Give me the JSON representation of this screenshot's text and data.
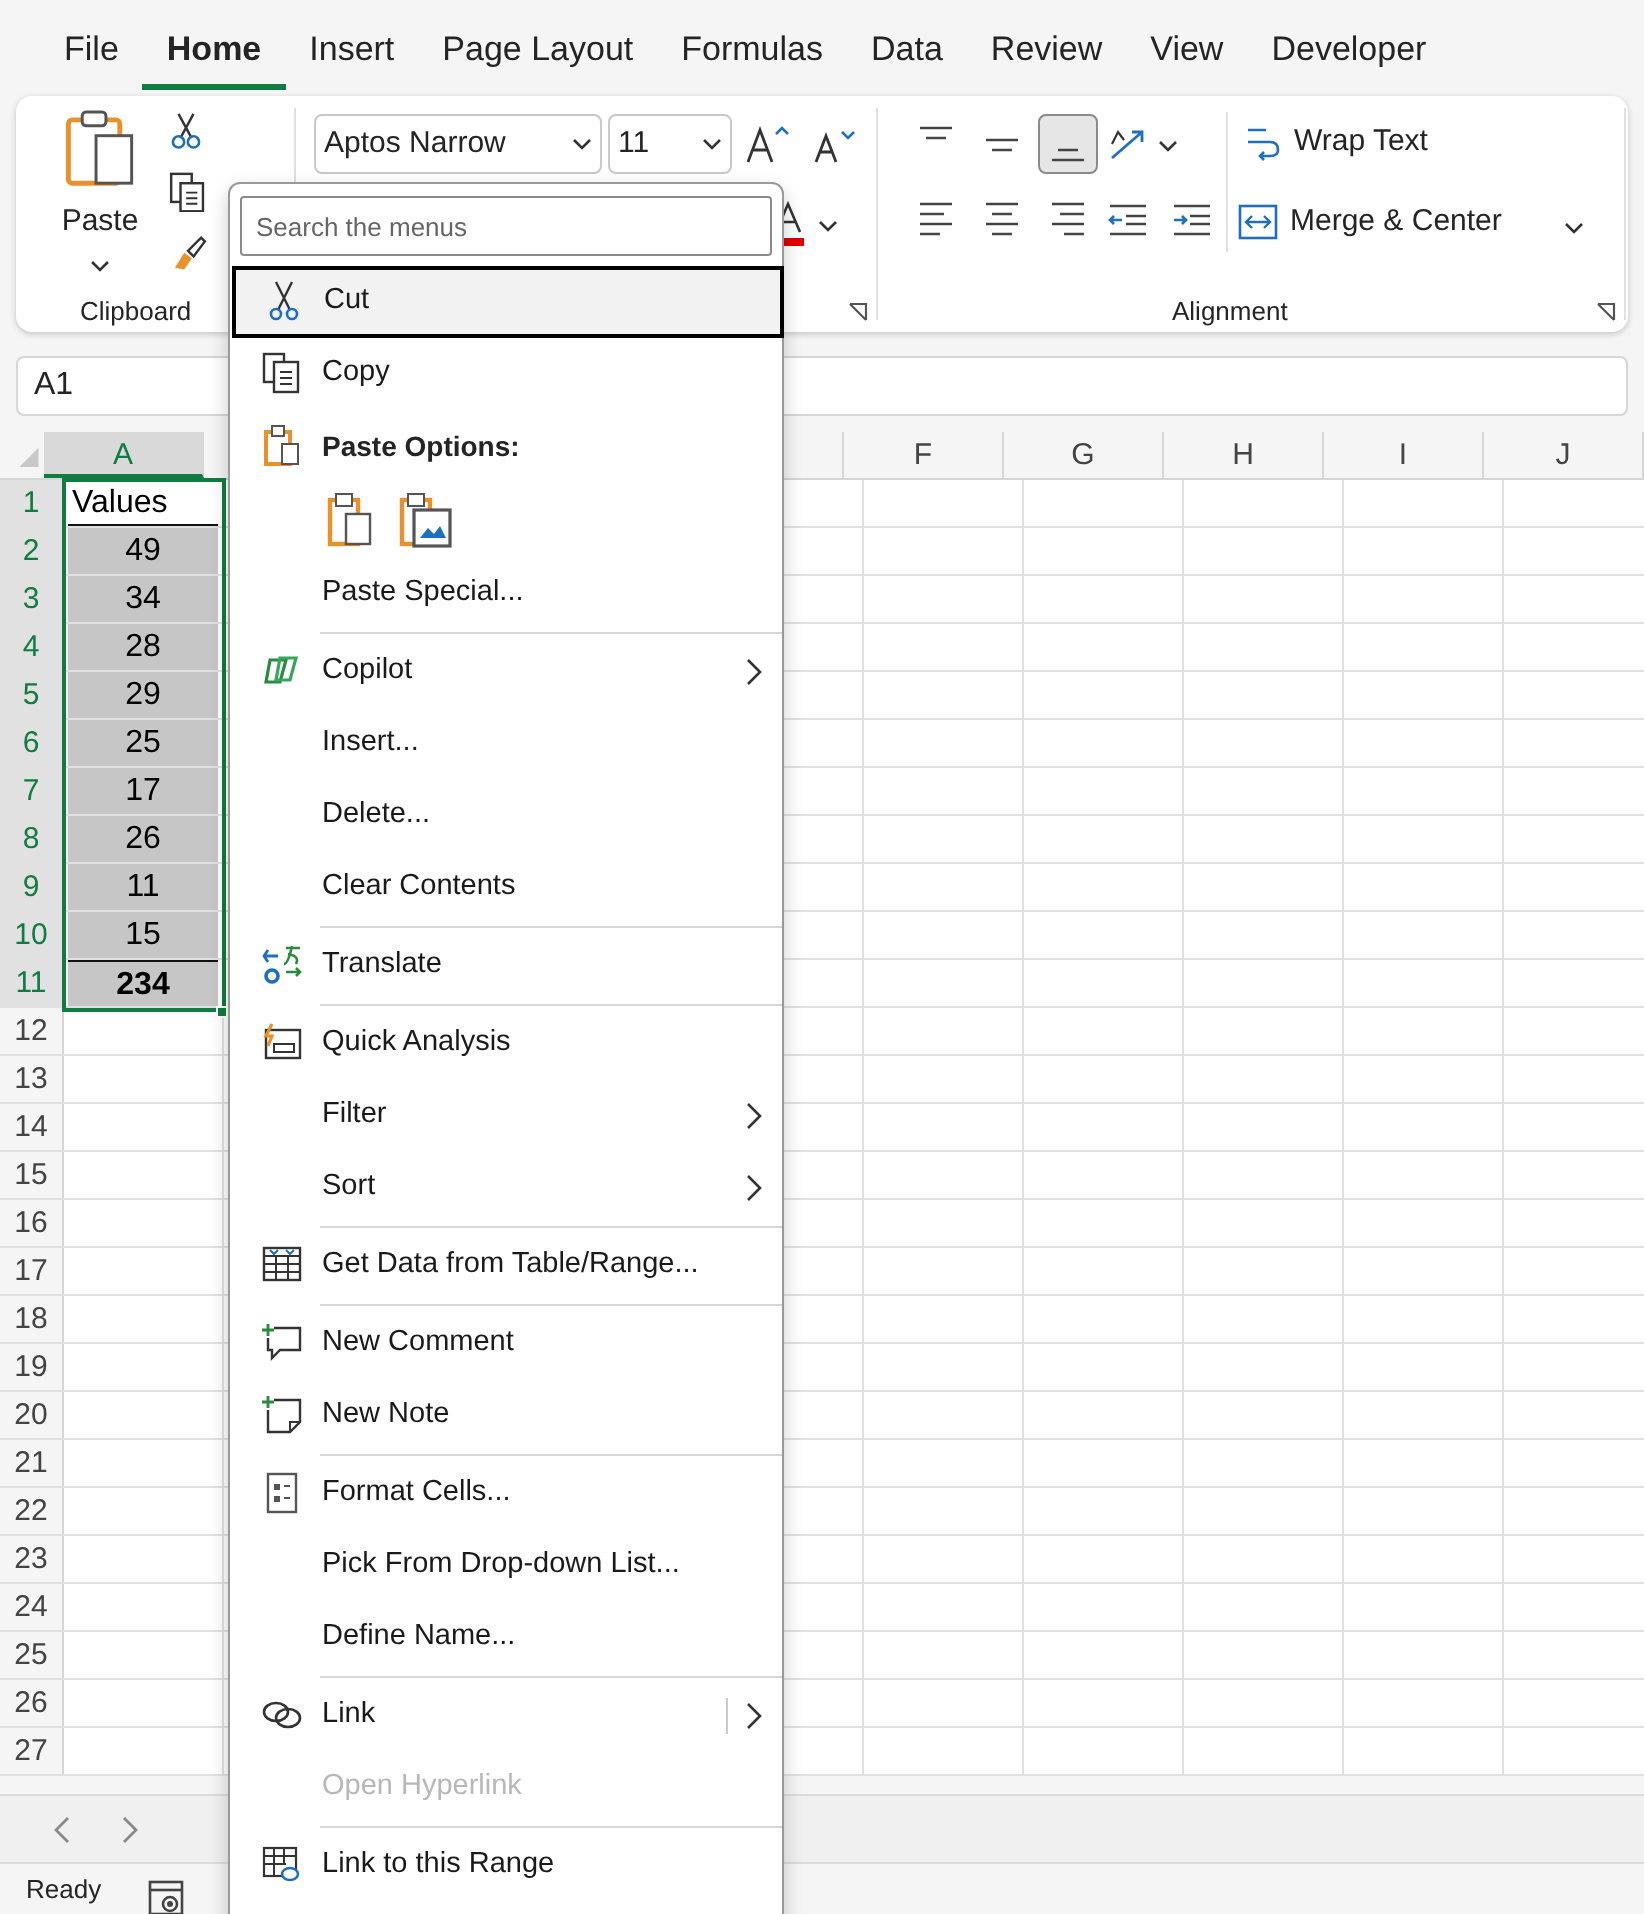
{
  "tabs": [
    {
      "label": "File",
      "selected": false
    },
    {
      "label": "Home",
      "selected": true
    },
    {
      "label": "Insert",
      "selected": false
    },
    {
      "label": "Page Layout",
      "selected": false
    },
    {
      "label": "Formulas",
      "selected": false
    },
    {
      "label": "Data",
      "selected": false
    },
    {
      "label": "Review",
      "selected": false
    },
    {
      "label": "View",
      "selected": false
    },
    {
      "label": "Developer",
      "selected": false
    }
  ],
  "ribbon": {
    "clipboard": {
      "paste": "Paste",
      "label": "Clipboard"
    },
    "font": {
      "name": "Aptos Narrow",
      "size": "11"
    },
    "alignment": {
      "vertical": [
        {
          "selected": false
        },
        {
          "selected": false
        },
        {
          "selected": true
        }
      ],
      "wrap": "Wrap Text",
      "merge": "Merge & Center",
      "label": "Alignment"
    }
  },
  "formula_bar": {
    "name_box": "A1"
  },
  "sheet": {
    "columns": [
      {
        "label": "A",
        "selected": true
      },
      {
        "label": "F",
        "selected": false
      },
      {
        "label": "G",
        "selected": false
      },
      {
        "label": "H",
        "selected": false
      },
      {
        "label": "I",
        "selected": false
      },
      {
        "label": "J",
        "selected": false
      }
    ],
    "rows": [
      {
        "number": "1",
        "selected": true,
        "cell": {
          "kind": "header",
          "text": "Values"
        }
      },
      {
        "number": "2",
        "selected": true,
        "cell": {
          "kind": "value",
          "text": "49"
        }
      },
      {
        "number": "3",
        "selected": true,
        "cell": {
          "kind": "value",
          "text": "34"
        }
      },
      {
        "number": "4",
        "selected": true,
        "cell": {
          "kind": "value",
          "text": "28"
        }
      },
      {
        "number": "5",
        "selected": true,
        "cell": {
          "kind": "value",
          "text": "29"
        }
      },
      {
        "number": "6",
        "selected": true,
        "cell": {
          "kind": "value",
          "text": "25"
        }
      },
      {
        "number": "7",
        "selected": true,
        "cell": {
          "kind": "value",
          "text": "17"
        }
      },
      {
        "number": "8",
        "selected": true,
        "cell": {
          "kind": "value",
          "text": "26"
        }
      },
      {
        "number": "9",
        "selected": true,
        "cell": {
          "kind": "value",
          "text": "11"
        }
      },
      {
        "number": "10",
        "selected": true,
        "cell": {
          "kind": "value",
          "text": "15"
        }
      },
      {
        "number": "11",
        "selected": true,
        "cell": {
          "kind": "total",
          "text": "234"
        }
      },
      {
        "number": "12",
        "selected": false
      },
      {
        "number": "13",
        "selected": false
      },
      {
        "number": "14",
        "selected": false
      },
      {
        "number": "15",
        "selected": false
      },
      {
        "number": "16",
        "selected": false
      },
      {
        "number": "17",
        "selected": false
      },
      {
        "number": "18",
        "selected": false
      },
      {
        "number": "19",
        "selected": false
      },
      {
        "number": "20",
        "selected": false
      },
      {
        "number": "21",
        "selected": false
      },
      {
        "number": "22",
        "selected": false
      },
      {
        "number": "23",
        "selected": false
      },
      {
        "number": "24",
        "selected": false
      },
      {
        "number": "25",
        "selected": false
      },
      {
        "number": "26",
        "selected": false
      },
      {
        "number": "27",
        "selected": false
      }
    ]
  },
  "status_bar": {
    "status": "Ready"
  },
  "context_menu": {
    "search": {
      "placeholder": "Search the menus"
    },
    "items": [
      {
        "kind": "item",
        "label": "Cut",
        "submenu": false,
        "disabled": false,
        "selected": true
      },
      {
        "kind": "item",
        "label": "Copy",
        "submenu": false,
        "disabled": false,
        "selected": false
      },
      {
        "kind": "header",
        "label": "Paste Options:"
      },
      {
        "kind": "paste-icons"
      },
      {
        "kind": "item",
        "label": "Paste Special...",
        "submenu": false,
        "disabled": false,
        "selected": false
      },
      {
        "kind": "separator"
      },
      {
        "kind": "item",
        "label": "Copilot",
        "submenu": true,
        "disabled": false,
        "selected": false
      },
      {
        "kind": "item",
        "label": "Insert...",
        "submenu": false,
        "disabled": false,
        "selected": false
      },
      {
        "kind": "item",
        "label": "Delete...",
        "submenu": false,
        "disabled": false,
        "selected": false
      },
      {
        "kind": "item",
        "label": "Clear Contents",
        "submenu": false,
        "disabled": false,
        "selected": false
      },
      {
        "kind": "separator"
      },
      {
        "kind": "item",
        "label": "Translate",
        "submenu": false,
        "disabled": false,
        "selected": false
      },
      {
        "kind": "separator"
      },
      {
        "kind": "item",
        "label": "Quick Analysis",
        "submenu": false,
        "disabled": false,
        "selected": false
      },
      {
        "kind": "item",
        "label": "Filter",
        "submenu": true,
        "disabled": false,
        "selected": false
      },
      {
        "kind": "item",
        "label": "Sort",
        "submenu": true,
        "disabled": false,
        "selected": false
      },
      {
        "kind": "separator"
      },
      {
        "kind": "item",
        "label": "Get Data from Table/Range...",
        "submenu": false,
        "disabled": false,
        "selected": false
      },
      {
        "kind": "separator"
      },
      {
        "kind": "item",
        "label": "New Comment",
        "submenu": false,
        "disabled": false,
        "selected": false
      },
      {
        "kind": "item",
        "label": "New Note",
        "submenu": false,
        "disabled": false,
        "selected": false
      },
      {
        "kind": "separator"
      },
      {
        "kind": "item",
        "label": "Format Cells...",
        "submenu": false,
        "disabled": false,
        "selected": false
      },
      {
        "kind": "item",
        "label": "Pick From Drop-down List...",
        "submenu": false,
        "disabled": false,
        "selected": false
      },
      {
        "kind": "item",
        "label": "Define Name...",
        "submenu": false,
        "disabled": false,
        "selected": false
      },
      {
        "kind": "separator"
      },
      {
        "kind": "item",
        "label": "Link",
        "submenu": true,
        "disabled": false,
        "selected": false
      },
      {
        "kind": "item",
        "label": "Open Hyperlink",
        "submenu": false,
        "disabled": true,
        "selected": false
      },
      {
        "kind": "separator"
      },
      {
        "kind": "item",
        "label": "Link to this Range",
        "submenu": false,
        "disabled": false,
        "selected": false
      }
    ]
  }
}
